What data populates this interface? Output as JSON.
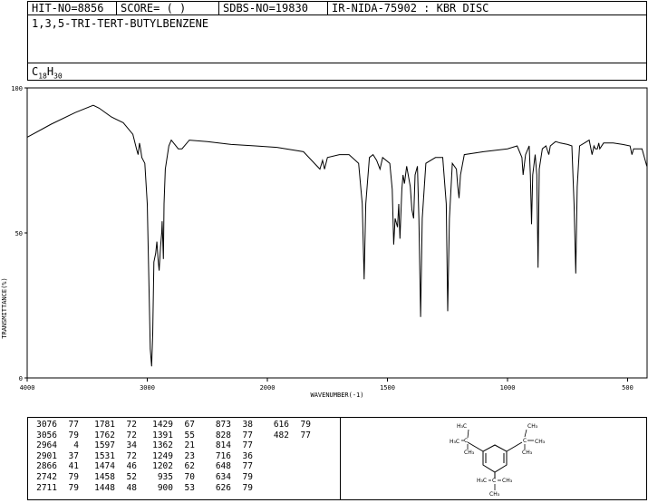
{
  "header": {
    "hit_no": "HIT-NO=8856",
    "score": "SCORE=  (   )",
    "sdbs_no": "SDBS-NO=19830",
    "ir": "IR-NIDA-75902 : KBR DISC"
  },
  "compound_name": "1,3,5-TRI-TERT-BUTYLBENZENE",
  "formula": {
    "c": "C",
    "c_sub": "18",
    "h": "H",
    "h_sub": "30"
  },
  "chart_data": {
    "type": "line",
    "title": "",
    "xlabel": "WAVENUMBER(-1)",
    "ylabel": "TRANSMITTANCE(%)",
    "xlim": [
      4000,
      420
    ],
    "ylim": [
      0,
      100
    ],
    "x_ticks": [
      "4000",
      "3000",
      "2000",
      "1500",
      "1000",
      "500"
    ],
    "y_ticks": [
      "100",
      "50",
      "0"
    ],
    "series": [
      {
        "values": [
          [
            4000,
            83
          ],
          [
            3800,
            87.5
          ],
          [
            3600,
            91.5
          ],
          [
            3450,
            94
          ],
          [
            3400,
            93
          ],
          [
            3300,
            90
          ],
          [
            3200,
            88
          ],
          [
            3120,
            84
          ],
          [
            3090,
            79
          ],
          [
            3076,
            77
          ],
          [
            3065,
            81
          ],
          [
            3056,
            79
          ],
          [
            3045,
            76
          ],
          [
            3020,
            74
          ],
          [
            3000,
            60
          ],
          [
            2985,
            30
          ],
          [
            2975,
            10
          ],
          [
            2964,
            4
          ],
          [
            2955,
            15
          ],
          [
            2945,
            40
          ],
          [
            2930,
            43
          ],
          [
            2920,
            47
          ],
          [
            2910,
            41
          ],
          [
            2901,
            37
          ],
          [
            2890,
            45
          ],
          [
            2880,
            50
          ],
          [
            2876,
            54
          ],
          [
            2866,
            41
          ],
          [
            2860,
            60
          ],
          [
            2850,
            72
          ],
          [
            2820,
            80
          ],
          [
            2800,
            82
          ],
          [
            2742,
            79
          ],
          [
            2711,
            79
          ],
          [
            2650,
            82
          ],
          [
            2500,
            81.5
          ],
          [
            2300,
            80.5
          ],
          [
            2100,
            80
          ],
          [
            1960,
            79.5
          ],
          [
            1850,
            78
          ],
          [
            1781,
            72
          ],
          [
            1770,
            75
          ],
          [
            1762,
            72
          ],
          [
            1750,
            76
          ],
          [
            1700,
            77
          ],
          [
            1660,
            77
          ],
          [
            1620,
            74
          ],
          [
            1605,
            60
          ],
          [
            1597,
            34
          ],
          [
            1590,
            60
          ],
          [
            1575,
            76
          ],
          [
            1560,
            77
          ],
          [
            1545,
            75
          ],
          [
            1531,
            72
          ],
          [
            1520,
            76
          ],
          [
            1490,
            74
          ],
          [
            1480,
            65
          ],
          [
            1474,
            46
          ],
          [
            1468,
            55
          ],
          [
            1458,
            52
          ],
          [
            1453,
            60
          ],
          [
            1448,
            48
          ],
          [
            1440,
            65
          ],
          [
            1435,
            70
          ],
          [
            1429,
            67
          ],
          [
            1420,
            73
          ],
          [
            1405,
            66
          ],
          [
            1398,
            58
          ],
          [
            1391,
            55
          ],
          [
            1385,
            70
          ],
          [
            1375,
            73
          ],
          [
            1369,
            55
          ],
          [
            1362,
            21
          ],
          [
            1355,
            55
          ],
          [
            1340,
            74
          ],
          [
            1300,
            76
          ],
          [
            1270,
            76
          ],
          [
            1255,
            60
          ],
          [
            1249,
            23
          ],
          [
            1242,
            55
          ],
          [
            1230,
            74
          ],
          [
            1213,
            72
          ],
          [
            1207,
            66
          ],
          [
            1202,
            62
          ],
          [
            1196,
            70
          ],
          [
            1180,
            77
          ],
          [
            1100,
            78
          ],
          [
            1000,
            79
          ],
          [
            960,
            80
          ],
          [
            940,
            76
          ],
          [
            935,
            70
          ],
          [
            925,
            77
          ],
          [
            910,
            80
          ],
          [
            905,
            70
          ],
          [
            900,
            53
          ],
          [
            895,
            70
          ],
          [
            885,
            77
          ],
          [
            878,
            70
          ],
          [
            873,
            38
          ],
          [
            868,
            72
          ],
          [
            855,
            79
          ],
          [
            840,
            80
          ],
          [
            832,
            78
          ],
          [
            828,
            77
          ],
          [
            822,
            80
          ],
          [
            800,
            81.5
          ],
          [
            780,
            81
          ],
          [
            750,
            80.5
          ],
          [
            732,
            80
          ],
          [
            723,
            60
          ],
          [
            716,
            36
          ],
          [
            710,
            66
          ],
          [
            700,
            80
          ],
          [
            680,
            81
          ],
          [
            660,
            82
          ],
          [
            648,
            77
          ],
          [
            640,
            80
          ],
          [
            634,
            79
          ],
          [
            626,
            79
          ],
          [
            620,
            81
          ],
          [
            616,
            79
          ],
          [
            600,
            81
          ],
          [
            560,
            81
          ],
          [
            520,
            80.5
          ],
          [
            490,
            80
          ],
          [
            482,
            77
          ],
          [
            475,
            79
          ],
          [
            440,
            79
          ],
          [
            420,
            73
          ]
        ]
      }
    ],
    "peak_table": [
      [
        [
          "3076",
          "77"
        ],
        [
          "3056",
          "79"
        ],
        [
          "2964",
          "4"
        ],
        [
          "2901",
          "37"
        ],
        [
          "2866",
          "41"
        ],
        [
          "2742",
          "79"
        ],
        [
          "2711",
          "79"
        ]
      ],
      [
        [
          "1781",
          "72"
        ],
        [
          "1762",
          "72"
        ],
        [
          "1597",
          "34"
        ],
        [
          "1531",
          "72"
        ],
        [
          "1474",
          "46"
        ],
        [
          "1458",
          "52"
        ],
        [
          "1448",
          "48"
        ]
      ],
      [
        [
          "1429",
          "67"
        ],
        [
          "1391",
          "55"
        ],
        [
          "1362",
          "21"
        ],
        [
          "1249",
          "23"
        ],
        [
          "1202",
          "62"
        ],
        [
          "935",
          "70"
        ],
        [
          "900",
          "53"
        ]
      ],
      [
        [
          "873",
          "38"
        ],
        [
          "828",
          "77"
        ],
        [
          "814",
          "77"
        ],
        [
          "716",
          "36"
        ],
        [
          "648",
          "77"
        ],
        [
          "634",
          "79"
        ],
        [
          "626",
          "79"
        ]
      ],
      [
        [
          "616",
          "79"
        ],
        [
          "482",
          "77"
        ]
      ]
    ]
  },
  "structure_labels": {
    "h3c_1": "H₃C",
    "h3c_2": "H₃C",
    "h3c_3": "H₃C",
    "c1": "C",
    "c2": "C",
    "c3": "C",
    "ch3_1": "CH₃",
    "ch3_2": "CH₃",
    "ch3_3": "CH₃",
    "ch3_4": "CH₃",
    "ch3_5": "CH₃",
    "ch3_6": "CH₃"
  }
}
